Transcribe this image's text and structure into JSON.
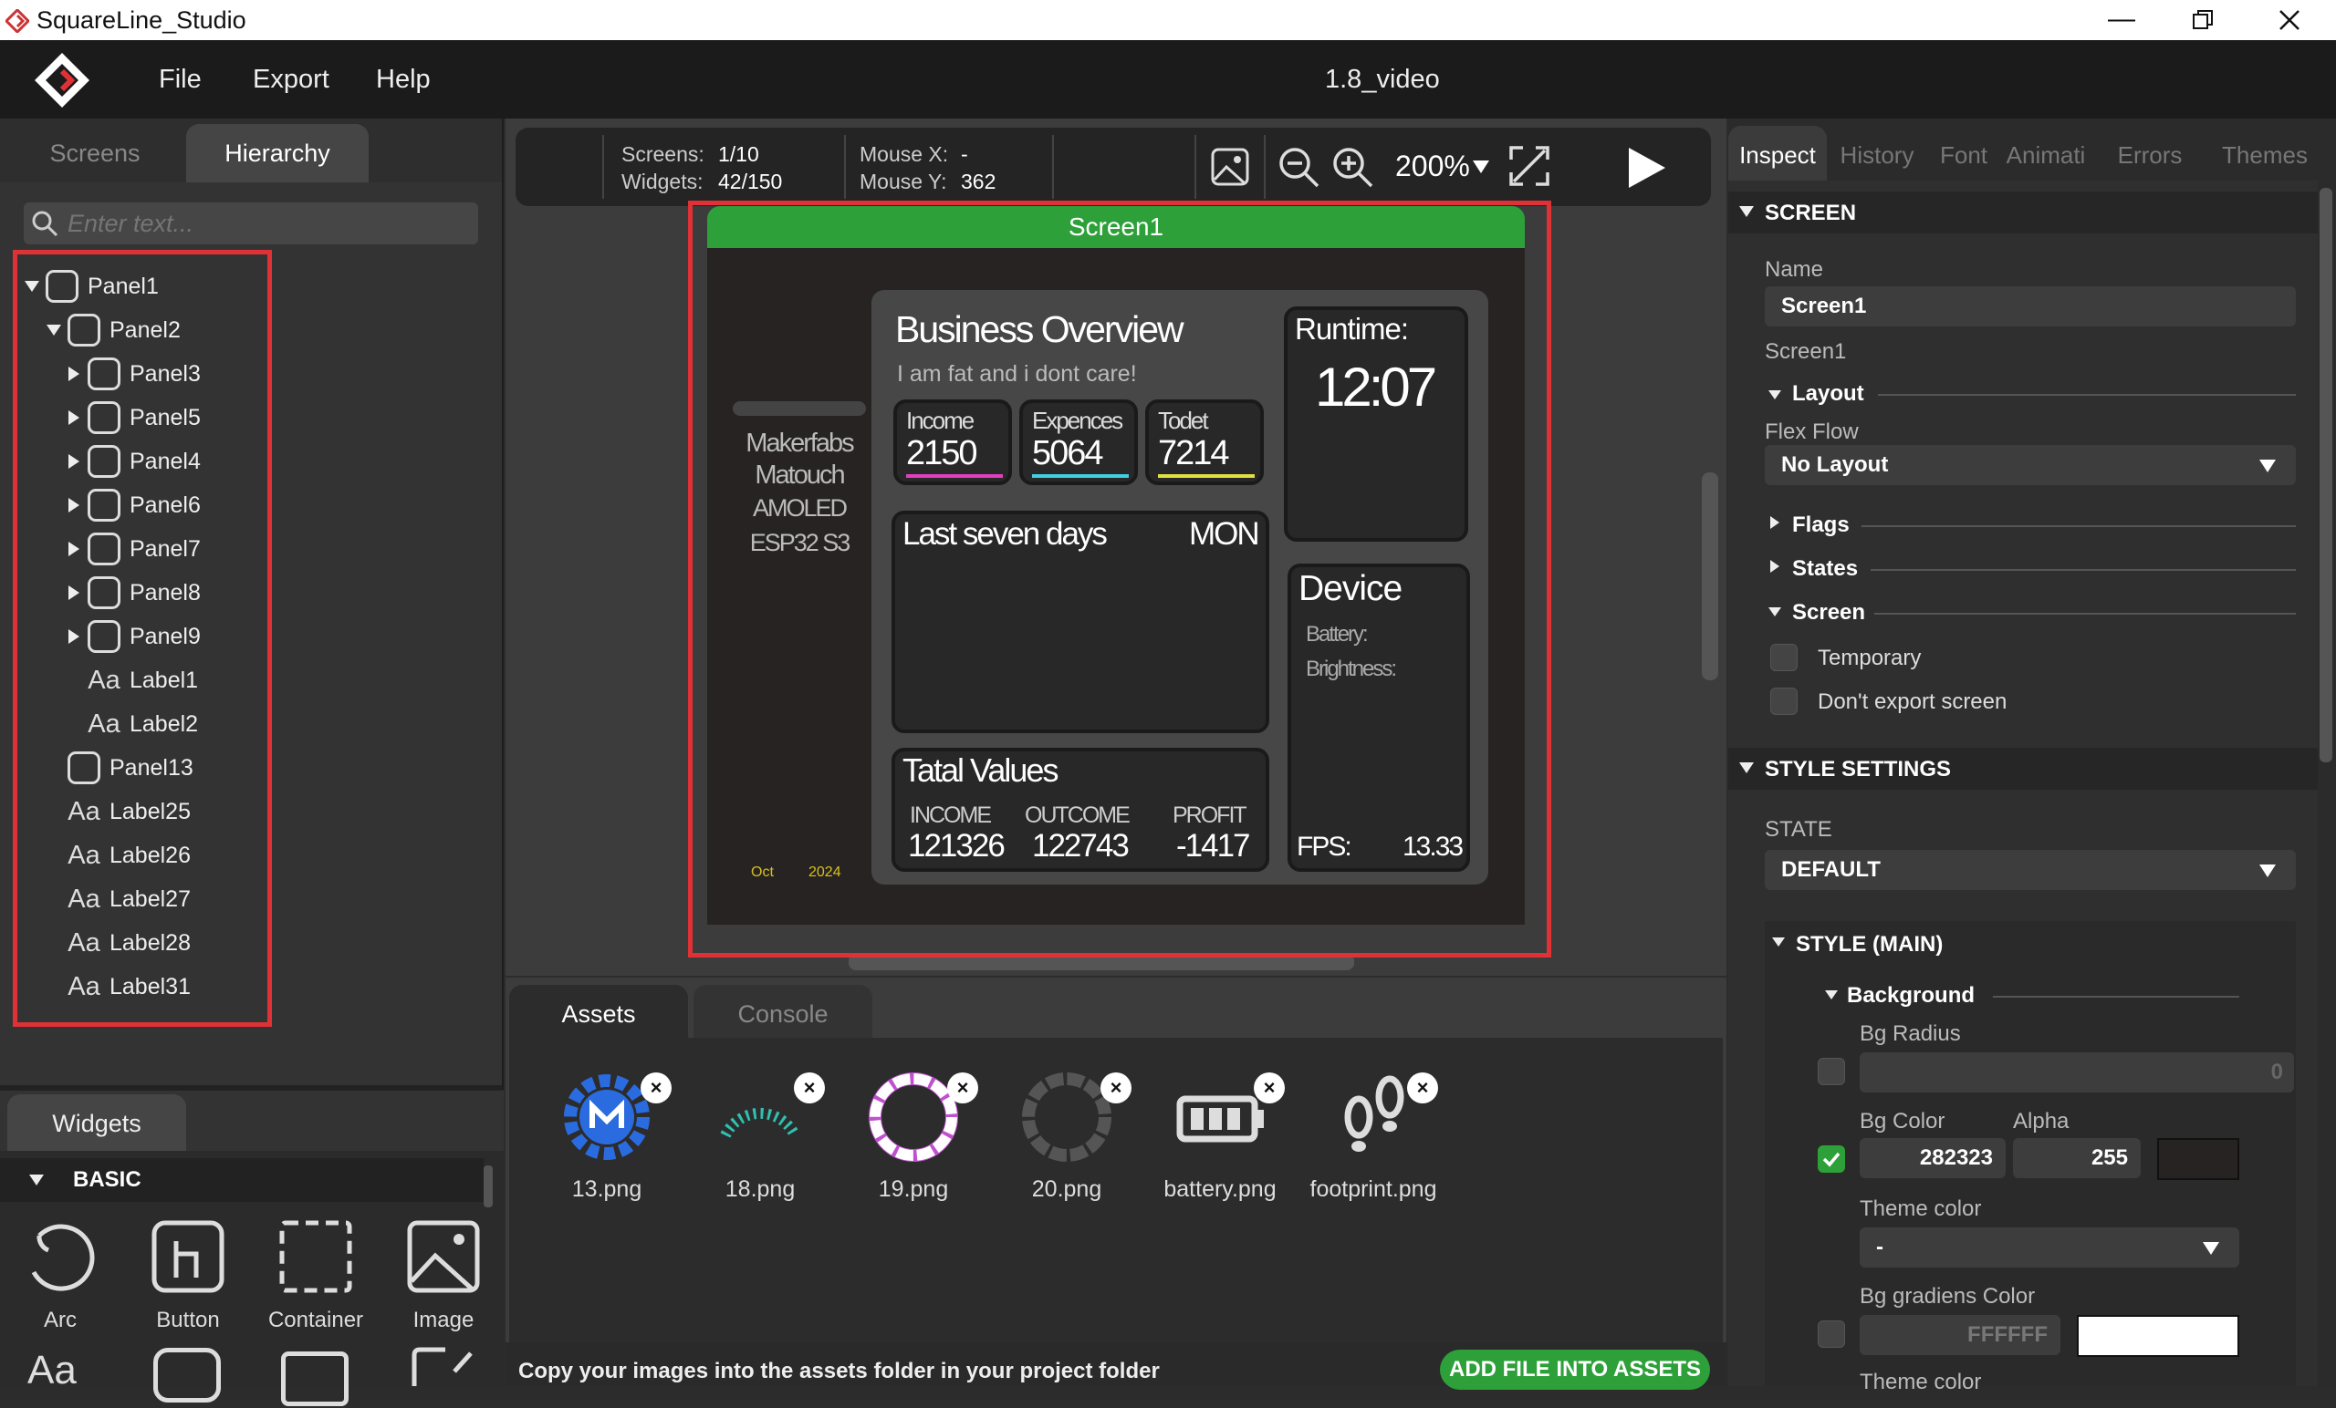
{
  "window": {
    "title": "SquareLine_Studio",
    "project": "1.8_video"
  },
  "menu": {
    "file": "File",
    "export": "Export",
    "help": "Help"
  },
  "left": {
    "tabs": {
      "screens": "Screens",
      "hierarchy": "Hierarchy"
    },
    "search_placeholder": "Enter text...",
    "tree": [
      "Panel1",
      "Panel2",
      "Panel3",
      "Panel5",
      "Panel4",
      "Panel6",
      "Panel7",
      "Panel8",
      "Panel9",
      "Label1",
      "Label2",
      "Panel13",
      "Label25",
      "Label26",
      "Label27",
      "Label28",
      "Label31"
    ],
    "widgets_tab": "Widgets",
    "basic": "BASIC",
    "widgets": [
      "Arc",
      "Button",
      "Container",
      "Image"
    ]
  },
  "toolbar": {
    "screens_label": "Screens:",
    "screens_val": "1/10",
    "widgets_label": "Widgets:",
    "widgets_val": "42/150",
    "mousex_label": "Mouse X:",
    "mousex_val": "-",
    "mousey_label": "Mouse Y:",
    "mousey_val": "362",
    "zoom": "200%"
  },
  "canvas": {
    "screen_name": "Screen1",
    "side": {
      "l1": "Makerfabs",
      "l2": "Matouch",
      "l3": "AMOLED",
      "l4": "ESP32 S3",
      "month": "Oct",
      "year": "2024"
    },
    "overview": {
      "title": "Business Overview",
      "subtitle": "I am fat and i dont care!"
    },
    "stats": [
      {
        "label": "Income",
        "value": "2150",
        "color": "#e040c0"
      },
      {
        "label": "Expences",
        "value": "5064",
        "color": "#40d0e0"
      },
      {
        "label": "Todet",
        "value": "7214",
        "color": "#e0e040"
      }
    ],
    "week": {
      "title": "Last seven days",
      "day": "MON"
    },
    "totals": {
      "title": "Tatal Values",
      "income_label": "INCOME",
      "income": "121326",
      "outcome_label": "OUTCOME",
      "outcome": "122743",
      "profit_label": "PROFIT",
      "profit": "-1417"
    },
    "runtime": {
      "label": "Runtime:",
      "value": "12:07"
    },
    "device": {
      "title": "Device",
      "battery": "Battery:",
      "brightness": "Brightness:",
      "fps_label": "FPS:",
      "fps": "13.33"
    }
  },
  "bottom": {
    "tabs": {
      "assets": "Assets",
      "console": "Console"
    },
    "assets": [
      "13.png",
      "18.png",
      "19.png",
      "20.png",
      "battery.png",
      "footprint.png"
    ],
    "hint": "Copy your images into the assets folder in your project folder",
    "add_button": "ADD FILE INTO ASSETS"
  },
  "right": {
    "tabs": [
      "Inspect",
      "History",
      "Font",
      "Animati",
      "Errors",
      "Themes"
    ],
    "screen_section": "SCREEN",
    "name_label": "Name",
    "name_value": "Screen1",
    "name_sub": "Screen1",
    "layout": "Layout",
    "flex_flow": "Flex Flow",
    "flex_value": "No Layout",
    "flags": "Flags",
    "states": "States",
    "screen_sub": "Screen",
    "temporary": "Temporary",
    "dont_export": "Don't export screen",
    "style_settings": "STYLE SETTINGS",
    "state_label": "STATE",
    "state_value": "DEFAULT",
    "style_main": "STYLE (MAIN)",
    "background": "Background",
    "bg_radius": "Bg Radius",
    "bg_radius_val": "0",
    "bg_color": "Bg Color",
    "alpha": "Alpha",
    "bg_color_val": "282323",
    "alpha_val": "255",
    "theme_color": "Theme color",
    "theme_val": "-",
    "grad_color": "Bg gradiens Color",
    "grad_val": "FFFFFF",
    "theme_color2": "Theme color",
    "swatch": "#282323"
  }
}
